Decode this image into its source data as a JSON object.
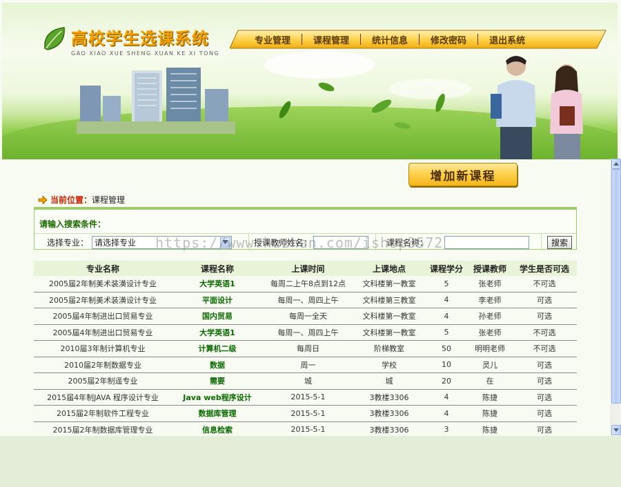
{
  "app": {
    "title_cn": "高校学生选课系统",
    "title_en": "GAO XIAO XUE SHENG XUAN KE XI TONG"
  },
  "nav": {
    "items": [
      {
        "label": "专业管理"
      },
      {
        "label": "课程管理"
      },
      {
        "label": "统计信息"
      },
      {
        "label": "修改密码"
      },
      {
        "label": "退出系统"
      }
    ]
  },
  "actions": {
    "add_course": "增加新课程"
  },
  "breadcrumb": {
    "label": "当前位置：",
    "value": "课程管理"
  },
  "search": {
    "title": "请输入搜索条件：",
    "major_label": "选择专业：",
    "major_selected": "请选择专业",
    "teacher_label": "授课教师姓名：",
    "teacher_value": "",
    "course_label": "课程名称：",
    "course_value": "",
    "button": "搜索"
  },
  "watermark": "https://www.huzhan.com/ishop3572",
  "table": {
    "headers": [
      "专业名称",
      "课程名称",
      "上课时间",
      "上课地点",
      "课程学分",
      "授课教师",
      "学生是否可选"
    ],
    "rows": [
      [
        "2005届2年制美术装潢设计专业",
        "大学英语1",
        "每周二上午8点到12点",
        "文科楼第一教室",
        "5",
        "张老师",
        "不可选"
      ],
      [
        "2005届2年制美术装潢设计专业",
        "平面设计",
        "每周一、周四上午",
        "文科楼第三教室",
        "4",
        "李老师",
        "可选"
      ],
      [
        "2005届4年制进出口贸易专业",
        "国内贸易",
        "每周一全天",
        "文科楼第一教室",
        "4",
        "孙老师",
        "可选"
      ],
      [
        "2005届4年制进出口贸易专业",
        "大学英语1",
        "每周一、周四上午",
        "文科楼第一教室",
        "5",
        "张老师",
        "不可选"
      ],
      [
        "2010届3年制计算机专业",
        "计算机二级",
        "每周日",
        "阶梯教室",
        "50",
        "明明老师",
        "不可选"
      ],
      [
        "2010届2年制数据专业",
        "数据",
        "周一",
        "学校",
        "10",
        "灵儿",
        "可选"
      ],
      [
        "2005届2年制遥专业",
        "需要",
        "城",
        "城",
        "20",
        "在",
        "可选"
      ],
      [
        "2015届4年制JAVA 程序设计专业",
        "Java web程序设计",
        "2015-5-1",
        "3教楼3306",
        "4",
        "陈捷",
        "可选"
      ],
      [
        "2015届2年制软件工程专业",
        "数据库管理",
        "2015-5-1",
        "3教楼3306",
        "4",
        "陈捷",
        "可选"
      ],
      [
        "2015届2年制数据库管理专业",
        "信息检索",
        "2015-5-1",
        "3教楼3306",
        "3",
        "陈捷",
        "可选"
      ]
    ]
  },
  "colors": {
    "accent_orange": "#f5a000",
    "nav_gold": "#ffd24e",
    "course_green": "#0a6a00",
    "breadcrumb_red": "#d02000",
    "panel_green": "#9ecb6a"
  },
  "icons": {
    "logo": "leaf-icon",
    "breadcrumb": "arrow-right-icon",
    "select": "chevron-down-icon",
    "scroll_up": "arrow-up-icon",
    "scroll_down": "arrow-down-icon"
  }
}
